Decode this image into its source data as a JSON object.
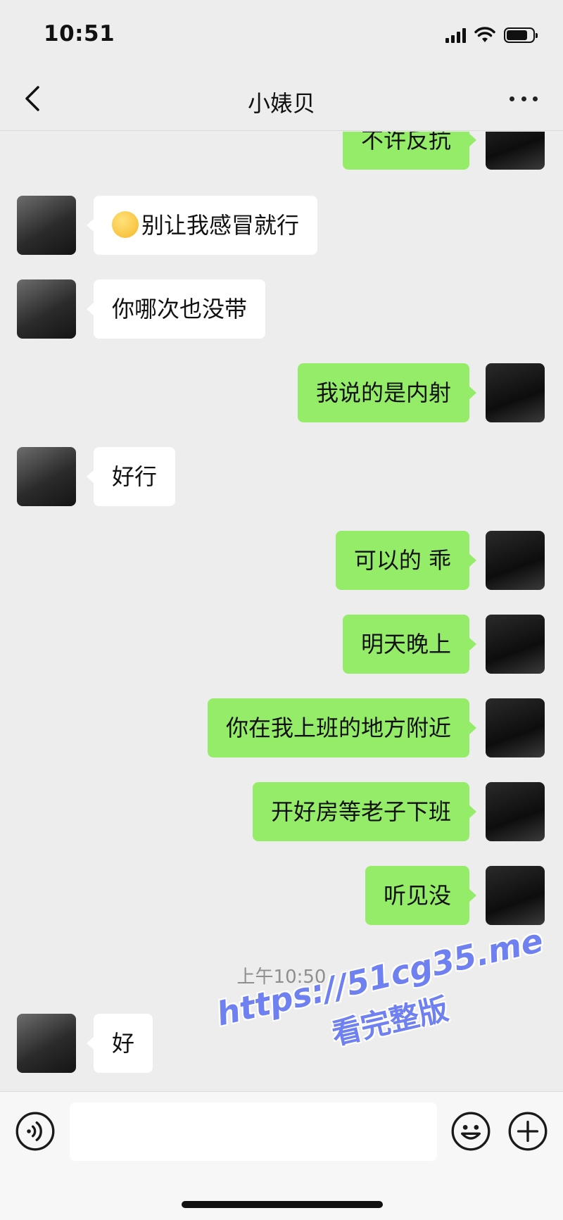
{
  "status_bar": {
    "time": "10:51"
  },
  "header": {
    "title": "小婊贝"
  },
  "messages": [
    {
      "side": "right",
      "text": "不许反抗"
    },
    {
      "side": "left",
      "text": "别让我感冒就行",
      "emoji": "sad-face-emoji"
    },
    {
      "side": "left",
      "text": "你哪次也没带"
    },
    {
      "side": "right",
      "text": "我说的是内射"
    },
    {
      "side": "left",
      "text": "好行"
    },
    {
      "side": "right",
      "text": "可以的 乖"
    },
    {
      "side": "right",
      "text": "明天晚上"
    },
    {
      "side": "right",
      "text": "你在我上班的地方附近"
    },
    {
      "side": "right",
      "text": "开好房等老子下班"
    },
    {
      "side": "right",
      "text": "听见没"
    },
    {
      "side": "left",
      "text": "好"
    }
  ],
  "timestamp": "上午10:50",
  "watermark": {
    "url": "https://51cg35.me",
    "caption": "看完整版"
  },
  "colors": {
    "background": "#ededed",
    "sent_bubble": "#95ec69",
    "received_bubble": "#ffffff",
    "watermark": "#6f80f0"
  }
}
